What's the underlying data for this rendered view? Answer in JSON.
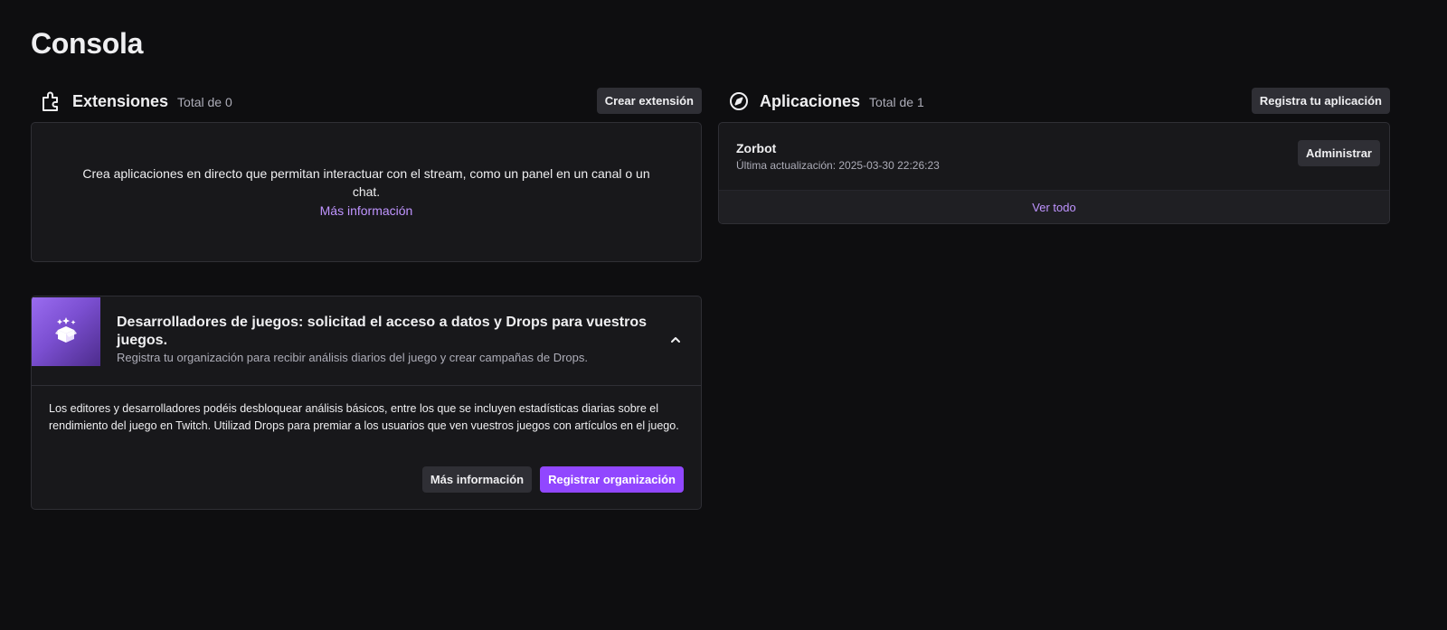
{
  "page": {
    "title": "Consola"
  },
  "extensions": {
    "icon": "puzzle-icon",
    "title": "Extensiones",
    "count": "Total de 0",
    "create_button": "Crear extensión",
    "empty_description": "Crea aplicaciones en directo que permitan interactuar con el stream, como un panel en un canal o un chat.",
    "more_info_link": "Más información"
  },
  "applications": {
    "icon": "compass-icon",
    "title": "Aplicaciones",
    "count": "Total de 1",
    "register_button": "Registra tu aplicación",
    "items": [
      {
        "name": "Zorbot",
        "updated": "Última actualización: 2025-03-30 22:26:23",
        "manage_button": "Administrar"
      }
    ],
    "see_all_link": "Ver todo"
  },
  "games": {
    "icon": "sparkle-box-icon",
    "title": "Desarrolladores de juegos: solicitad el acceso a datos y Drops para vuestros juegos.",
    "subtitle": "Registra tu organización para recibir análisis diarios del juego y crear campañas de Drops.",
    "body": "Los editores y desarrolladores podéis desbloquear análisis básicos, entre los que se incluyen estadísticas diarias sobre el rendimiento del juego en Twitch. Utilizad Drops para premiar a los usuarios que ven vuestros juegos con artículos en el juego.",
    "more_info_button": "Más información",
    "register_button": "Registrar organización",
    "collapse_icon": "chevron-up-icon"
  },
  "colors": {
    "background": "#0e0e10",
    "card": "#18181b",
    "accent": "#9147ff",
    "link": "#bf94ff"
  }
}
